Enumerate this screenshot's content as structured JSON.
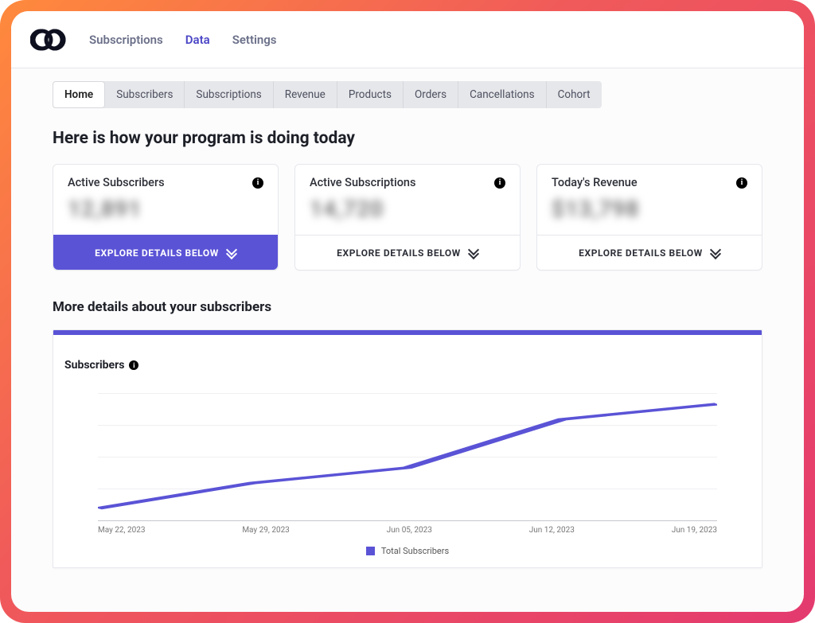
{
  "nav": {
    "items": [
      {
        "label": "Subscriptions",
        "active": false
      },
      {
        "label": "Data",
        "active": true
      },
      {
        "label": "Settings",
        "active": false
      }
    ]
  },
  "subtabs": {
    "items": [
      {
        "label": "Home",
        "active": true
      },
      {
        "label": "Subscribers",
        "active": false
      },
      {
        "label": "Subscriptions",
        "active": false
      },
      {
        "label": "Revenue",
        "active": false
      },
      {
        "label": "Products",
        "active": false
      },
      {
        "label": "Orders",
        "active": false
      },
      {
        "label": "Cancellations",
        "active": false
      },
      {
        "label": "Cohort",
        "active": false
      }
    ]
  },
  "heading": "Here is how your program is doing today",
  "cards": [
    {
      "title": "Active Subscribers",
      "value": "12,891",
      "cta": "EXPLORE DETAILS BELOW",
      "primary": true
    },
    {
      "title": "Active Subscriptions",
      "value": "14,720",
      "cta": "EXPLORE DETAILS BELOW",
      "primary": false
    },
    {
      "title": "Today's Revenue",
      "value": "$13,798",
      "cta": "EXPLORE DETAILS BELOW",
      "primary": false
    }
  ],
  "section_heading": "More details about your subscribers",
  "chart": {
    "title": "Subscribers",
    "legend": "Total Subscribers"
  },
  "chart_data": {
    "type": "line",
    "title": "Subscribers",
    "xlabel": "",
    "ylabel": "",
    "categories": [
      "May 22, 2023",
      "May 29, 2023",
      "Jun 05, 2023",
      "Jun 12, 2023",
      "Jun 19, 2023"
    ],
    "series": [
      {
        "name": "Total Subscribers",
        "values": [
          10,
          30,
          42,
          80,
          92
        ]
      }
    ],
    "ylim": [
      0,
      100
    ]
  }
}
